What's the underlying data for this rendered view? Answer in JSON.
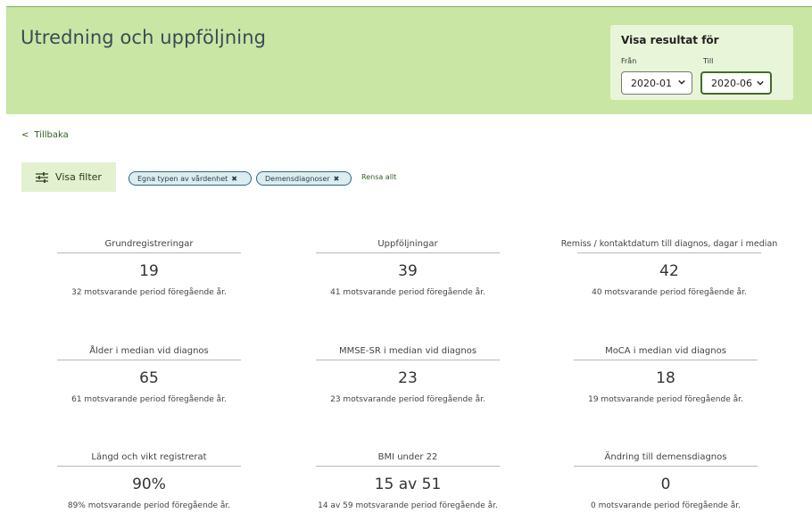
{
  "header": {
    "title": "Utredning och uppföljning",
    "period": {
      "title": "Visa resultat för",
      "from_label": "Från",
      "to_label": "Till",
      "from_value": "2020-01",
      "to_value": "2020-06"
    }
  },
  "nav": {
    "back_label": "Tillbaka"
  },
  "filters": {
    "button_label": "Visa filter",
    "chips": [
      "Egna typen av vårdenhet",
      "Demensdiagnoser"
    ],
    "clear_label": "Rensa allt"
  },
  "metrics": [
    {
      "label": "Grundregistreringar",
      "value": "19",
      "prev": "32 motsvarande period föregående år."
    },
    {
      "label": "Uppföljningar",
      "value": "39",
      "prev": "41 motsvarande period föregående år."
    },
    {
      "label": "Remiss / kontaktdatum till diagnos, dagar i median",
      "value": "42",
      "prev": "40 motsvarande period föregående år."
    },
    {
      "label": "Ålder i median vid diagnos",
      "value": "65",
      "prev": "61 motsvarande period föregående år."
    },
    {
      "label": "MMSE-SR i median vid diagnos",
      "value": "23",
      "prev": "23 motsvarande period föregående år."
    },
    {
      "label": "MoCA i median vid diagnos",
      "value": "18",
      "prev": "19 motsvarande period föregående år."
    },
    {
      "label": "Längd och vikt registrerat",
      "value": "90%",
      "prev": "89% motsvarande period föregående år."
    },
    {
      "label": "BMI under 22",
      "value": "15 av 51",
      "prev": "14 av 59 motsvarande period föregående år."
    },
    {
      "label": "Ändring till demensdiagnos",
      "value": "0",
      "prev": "0 motsvarande period föregående år."
    }
  ],
  "colors": {
    "header_bg": "#c9e6a4",
    "accent": "#3f6e2a",
    "chip_border": "#2a6a82"
  }
}
